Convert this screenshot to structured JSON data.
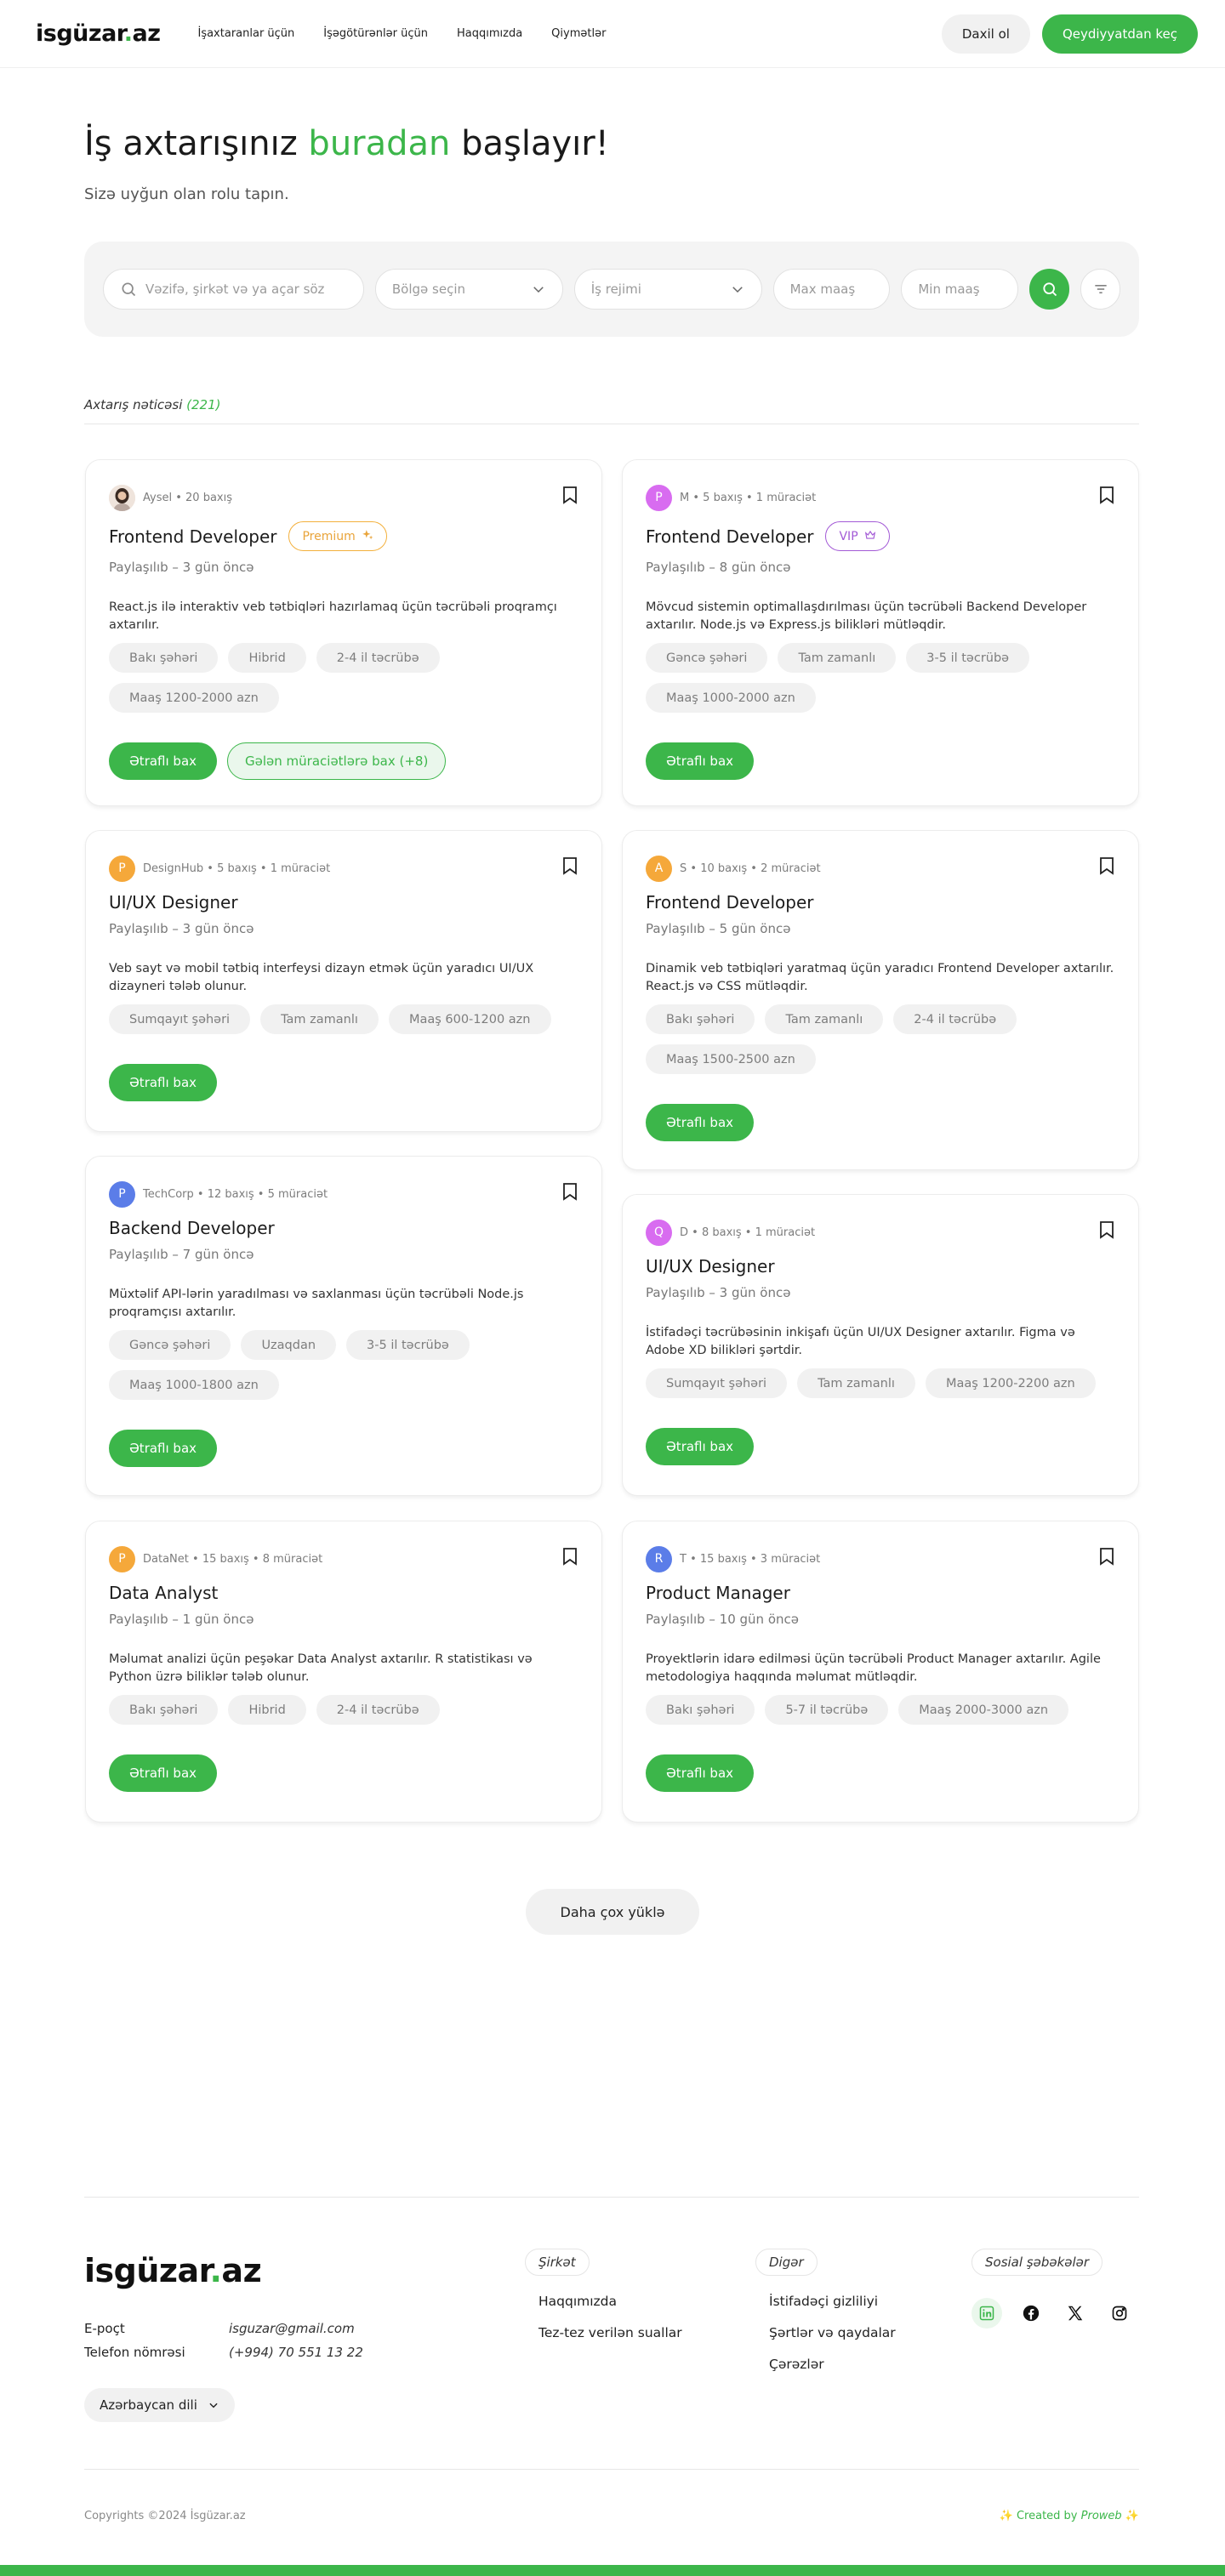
{
  "header": {
    "logo_main": "isgüzar",
    "logo_dots": ".",
    "logo_tld": "az",
    "nav": [
      "İşaxtaranlar üçün",
      "İşəgötürənlər üçün",
      "Haqqımızda",
      "Qiymətlər"
    ],
    "login": "Daxil ol",
    "register": "Qeydiyyatdan keç"
  },
  "hero": {
    "title_before": "İş axtarışınız ",
    "title_highlight": "buradan",
    "title_after": " başlayır!",
    "subtitle": "Sizə uyğun olan rolu tapın."
  },
  "search": {
    "keyword_placeholder": "Vəzifə, şirkət və ya açar söz",
    "region_placeholder": "Bölgə seçin",
    "mode_placeholder": "İş rejimi",
    "max_salary_placeholder": "Max maaş",
    "min_salary_placeholder": "Min maaş"
  },
  "results": {
    "label": "Axtarış nəticəsi",
    "count": "(221)"
  },
  "jobs": [
    {
      "company": "Aysel",
      "meta": "• 20 baxış",
      "title": "Frontend Developer",
      "badge": "Premium",
      "badge_type": "premium",
      "posted": "Paylaşılıb – 3 gün öncə",
      "desc": "React.js ilə interaktiv veb tətbiqləri hazırlamaq üçün təcrübəli proqramçı axtarılır.",
      "tags": [
        "Bakı şəhəri",
        "Hibrid",
        "2-4 il təcrübə",
        "Maaş 1200-2000 azn"
      ],
      "detail": "Ətraflı bax",
      "applications": "Gələn müraciətlərə bax (+8)",
      "avatar_letter": "",
      "avatar_color": "#e9dcd4"
    },
    {
      "company": "M",
      "meta": "• 5 baxış • 1 müraciət",
      "title": "Frontend Developer",
      "badge": "VIP",
      "badge_type": "vip",
      "posted": "Paylaşılıb – 8 gün öncə",
      "desc": "Mövcud sistemin optimallaşdırılması üçün təcrübəli Backend Developer axtarılır. Node.js və Express.js bilikləri mütləqdir.",
      "tags": [
        "Gəncə şəhəri",
        "Tam zamanlı",
        "3-5 il təcrübə",
        "Maaş 1000-2000 azn"
      ],
      "detail": "Ətraflı bax",
      "avatar_letter": "P",
      "avatar_color": "#d86cf0"
    },
    {
      "company": "DesignHub",
      "meta": "• 5 baxış • 1 müraciət",
      "title": "UI/UX Designer",
      "posted": "Paylaşılıb – 3 gün öncə",
      "desc": "Veb sayt və mobil tətbiq interfeysi dizayn etmək üçün yaradıcı UI/UX dizayneri tələb olunur.",
      "tags": [
        "Sumqayıt şəhəri",
        "Tam zamanlı",
        "Maaş 600-1200 azn"
      ],
      "detail": "Ətraflı bax",
      "avatar_letter": "P",
      "avatar_color": "#f5a83a"
    },
    {
      "company": "S",
      "meta": "• 10 baxış • 2 müraciət",
      "title": "Frontend Developer",
      "posted": "Paylaşılıb – 5 gün öncə",
      "desc": "Dinamik veb tətbiqləri yaratmaq üçün yaradıcı Frontend Developer axtarılır. React.js və CSS mütləqdir.",
      "tags": [
        "Bakı şəhəri",
        "Tam zamanlı",
        "2-4 il təcrübə",
        "Maaş 1500-2500 azn"
      ],
      "detail": "Ətraflı bax",
      "avatar_letter": "A",
      "avatar_color": "#f5a83a"
    },
    {
      "company": "TechCorp",
      "meta": "• 12 baxış • 5 müraciət",
      "title": "Backend Developer",
      "posted": "Paylaşılıb – 7 gün öncə",
      "desc": "Müxtəlif API-lərin yaradılması və saxlanması üçün təcrübəli Node.js proqramçısı axtarılır.",
      "tags": [
        "Gəncə şəhəri",
        "Uzaqdan",
        "3-5 il təcrübə",
        "Maaş 1000-1800 azn"
      ],
      "detail": "Ətraflı bax",
      "avatar_letter": "P",
      "avatar_color": "#5b7de8"
    },
    {
      "company": "D",
      "meta": "• 8 baxış • 1 müraciət",
      "title": "UI/UX Designer",
      "posted": "Paylaşılıb – 3 gün öncə",
      "desc": "İstifadəçi təcrübəsinin inkişafı üçün UI/UX Designer axtarılır. Figma və Adobe XD bilikləri şərtdir.",
      "tags": [
        "Sumqayıt şəhəri",
        "Tam zamanlı",
        "Maaş 1200-2200 azn"
      ],
      "detail": "Ətraflı bax",
      "avatar_letter": "Q",
      "avatar_color": "#d86cf0"
    },
    {
      "company": "DataNet",
      "meta": "• 15 baxış • 8 müraciət",
      "title": "Data Analyst",
      "posted": "Paylaşılıb – 1 gün öncə",
      "desc": "Məlumat analizi üçün peşəkar Data Analyst axtarılır. R statistikası və Python üzrə biliklər tələb olunur.",
      "tags": [
        "Bakı şəhəri",
        "Hibrid",
        "2-4 il təcrübə"
      ],
      "detail": "Ətraflı bax",
      "avatar_letter": "P",
      "avatar_color": "#f5a83a"
    },
    {
      "company": "T",
      "meta": "• 15 baxış • 3 müraciət",
      "title": "Product Manager",
      "posted": "Paylaşılıb – 10 gün öncə",
      "desc": "Proyektlərin idarə edilməsi üçün təcrübəli Product Manager axtarılır. Agile metodologiya haqqında məlumat mütləqdir.",
      "tags": [
        "Bakı şəhəri",
        "5-7 il təcrübə",
        "Maaş 2000-3000 azn"
      ],
      "detail": "Ətraflı bax",
      "avatar_letter": "R",
      "avatar_color": "#5b7de8"
    }
  ],
  "load_more": "Daha çox yüklə",
  "footer": {
    "email_label": "E-poçt",
    "email": "isguzar@gmail.com",
    "phone_label": "Telefon nömrəsi",
    "phone": "(+994) 70 551 13 22",
    "language": "Azərbaycan dili",
    "company_head": "Şirkət",
    "company_links": [
      "Haqqımızda",
      "Tez-tez verilən suallar"
    ],
    "other_head": "Digər",
    "other_links": [
      "İstifadəçi gizliliyi",
      "Şərtlər və qaydalar",
      "Çərəzlər"
    ],
    "social_head": "Sosial şəbəkələr",
    "socials": [
      "linkedin-icon",
      "facebook-icon",
      "x-icon",
      "instagram-icon"
    ],
    "copyright": "Copyrights ©2024 İsgüzar.az",
    "created_prefix": "✨ Created by ",
    "created_brand": "Proweb",
    "created_suffix": " ✨"
  },
  "colors": {
    "accent": "#3cb64a",
    "premium": "#f3b03c",
    "vip": "#a35ad6"
  }
}
